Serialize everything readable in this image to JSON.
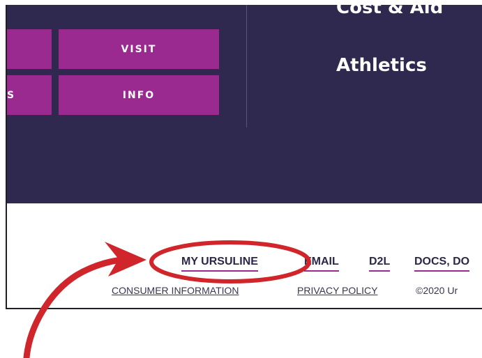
{
  "navigation": {
    "buttons": {
      "left_1": "",
      "left_2": "S",
      "visit": "VISIT",
      "info": "INFO"
    },
    "links": {
      "cost_aid": "Cost & Aid",
      "athletics": "Athletics"
    }
  },
  "footer": {
    "utility_links": {
      "my_ursuline": "MY URSULINE",
      "email": "EMAIL",
      "d2l": "D2L",
      "docs": "DOCS, DO"
    },
    "legal": {
      "consumer_information": "CONSUMER INFORMATION",
      "privacy_policy": "PRIVACY POLICY",
      "copyright": "©2020 Ur"
    }
  },
  "colors": {
    "header_bg": "#30294f",
    "button_bg": "#9a2990",
    "annotation_red": "#d0262b"
  },
  "annotation": {
    "icon": "red-curved-arrow-and-ellipse"
  }
}
